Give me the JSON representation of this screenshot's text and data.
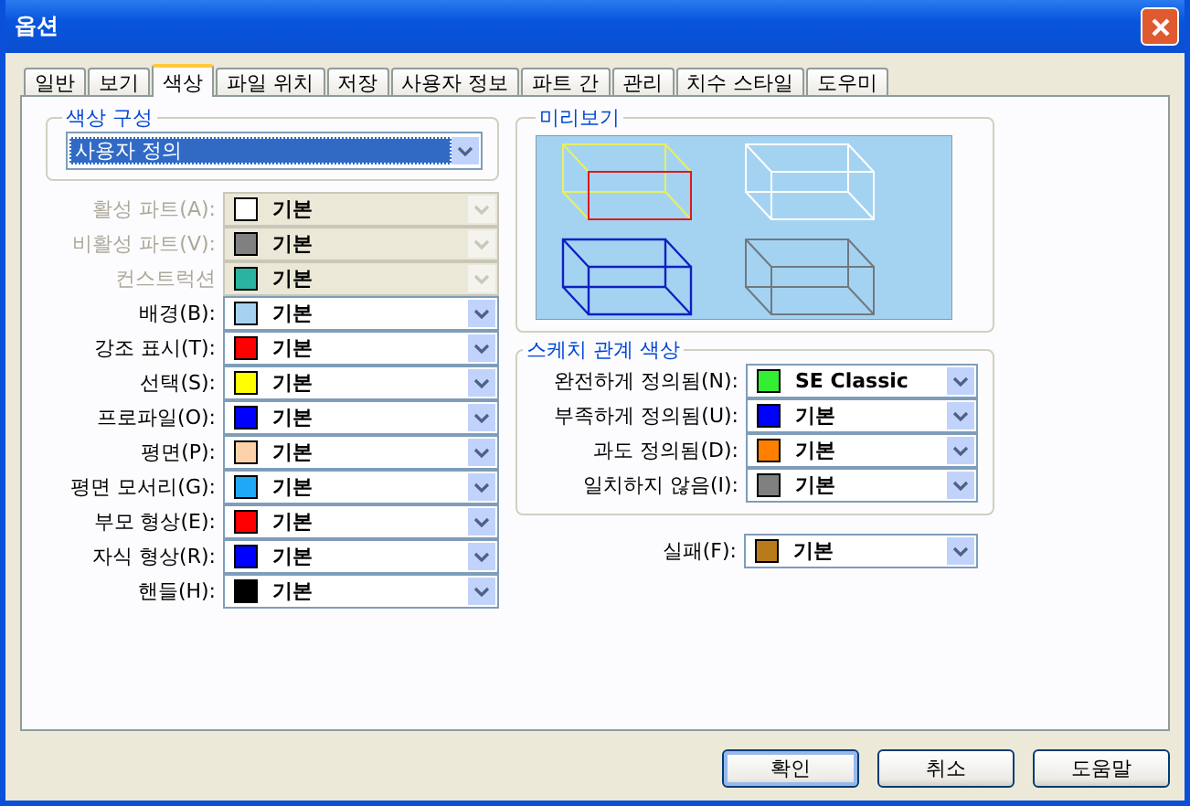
{
  "window": {
    "title": "옵션"
  },
  "tabs": [
    {
      "label": "일반",
      "selected": false
    },
    {
      "label": "보기",
      "selected": false
    },
    {
      "label": "색상",
      "selected": true
    },
    {
      "label": "파일 위치",
      "selected": false
    },
    {
      "label": "저장",
      "selected": false
    },
    {
      "label": "사용자 정보",
      "selected": false
    },
    {
      "label": "파트 간",
      "selected": false
    },
    {
      "label": "관리",
      "selected": false
    },
    {
      "label": "치수 스타일",
      "selected": false
    },
    {
      "label": "도우미",
      "selected": false
    }
  ],
  "color_scheme": {
    "label": "색상 구성",
    "value": "사용자 정의"
  },
  "colors": [
    {
      "label": "활성 파트(A):",
      "value": "기본",
      "color": "#ffffff",
      "disabled": true
    },
    {
      "label": "비활성 파트(V):",
      "value": "기본",
      "color": "#808080",
      "disabled": true
    },
    {
      "label": "컨스트럭션",
      "value": "기본",
      "color": "#2ab3a0",
      "disabled": true
    },
    {
      "label": "배경(B):",
      "value": "기본",
      "color": "#a6d2f0",
      "disabled": false
    },
    {
      "label": "강조 표시(T):",
      "value": "기본",
      "color": "#ff0000",
      "disabled": false
    },
    {
      "label": "선택(S):",
      "value": "기본",
      "color": "#ffff00",
      "disabled": false
    },
    {
      "label": "프로파일(O):",
      "value": "기본",
      "color": "#0000ff",
      "disabled": false
    },
    {
      "label": "평면(P):",
      "value": "기본",
      "color": "#fcd2aa",
      "disabled": false
    },
    {
      "label": "평면 모서리(G):",
      "value": "기본",
      "color": "#1ea8f5",
      "disabled": false
    },
    {
      "label": "부모 형상(E):",
      "value": "기본",
      "color": "#ff0000",
      "disabled": false
    },
    {
      "label": "자식 형상(R):",
      "value": "기본",
      "color": "#0000ff",
      "disabled": false
    },
    {
      "label": "핸들(H):",
      "value": "기본",
      "color": "#000000",
      "disabled": false
    }
  ],
  "preview": {
    "label": "미리보기"
  },
  "sketch_colors": {
    "label": "스케치 관계 색상",
    "items": [
      {
        "label": "완전하게 정의됨(N):",
        "value": "SE Classic",
        "color": "#33ee33"
      },
      {
        "label": "부족하게 정의됨(U):",
        "value": "기본",
        "color": "#0000ff"
      },
      {
        "label": "과도 정의됨(D):",
        "value": "기본",
        "color": "#ff8000"
      },
      {
        "label": "일치하지 않음(I):",
        "value": "기본",
        "color": "#808080"
      }
    ]
  },
  "failure": {
    "label": "실패(F):",
    "value": "기본",
    "color": "#b87a1a"
  },
  "buttons": [
    {
      "label": "확인",
      "default": true
    },
    {
      "label": "취소",
      "default": false
    },
    {
      "label": "도움말",
      "default": false
    }
  ]
}
